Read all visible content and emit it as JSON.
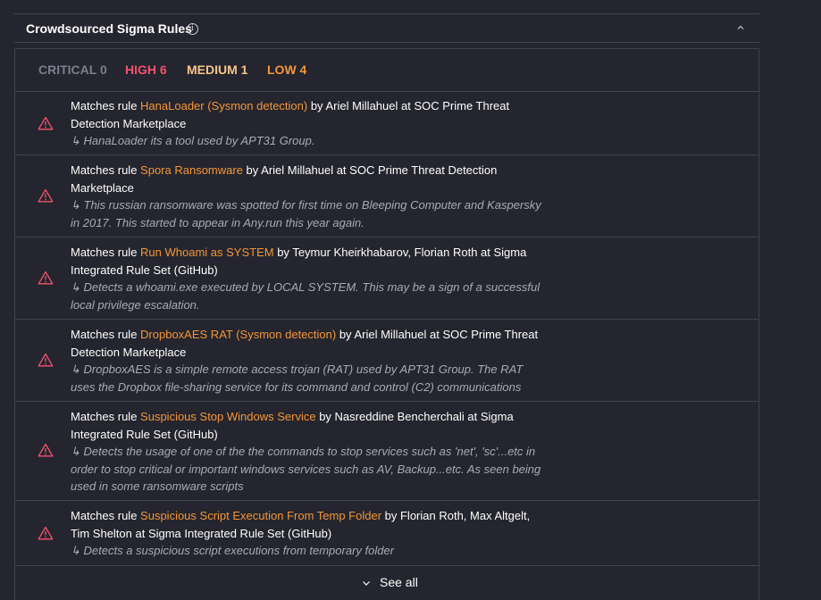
{
  "section": {
    "title": "Crowdsourced Sigma Rules",
    "info_icon": "info-icon",
    "collapse_icon": "chevron-up-icon"
  },
  "counts": [
    {
      "label": "CRITICAL 0",
      "color": "#7b7f8c"
    },
    {
      "label": "HIGH 6",
      "color": "#f5516e"
    },
    {
      "label": "MEDIUM 1",
      "color": "#f7c58a"
    },
    {
      "label": "LOW 4",
      "color": "#f59638"
    }
  ],
  "rules": [
    {
      "prefix": "Matches rule ",
      "name": "HanaLoader (Sysmon detection)",
      "suffix": " by Ariel Millahuel at SOC Prime Threat Detection Marketplace",
      "description": "↳ HanaLoader its a tool used by APT31 Group."
    },
    {
      "prefix": "Matches rule ",
      "name": "Spora Ransomware",
      "suffix": " by Ariel Millahuel at SOC Prime Threat Detection Marketplace",
      "description": "↳ This russian ransomware was spotted for first time on Bleeping Computer and Kaspersky in 2017. This started to appear in Any.run this year again."
    },
    {
      "prefix": "Matches rule ",
      "name": "Run Whoami as SYSTEM",
      "suffix": " by Teymur Kheirkhabarov, Florian Roth at Sigma Integrated Rule Set (GitHub)",
      "description": "↳ Detects a whoami.exe executed by LOCAL SYSTEM. This may be a sign of a successful local privilege escalation."
    },
    {
      "prefix": "Matches rule ",
      "name": "DropboxAES RAT (Sysmon detection)",
      "suffix": " by Ariel Millahuel at SOC Prime Threat Detection Marketplace",
      "description": "↳ DropboxAES is a simple remote access trojan (RAT) used by APT31 Group. The RAT uses the Dropbox file-sharing service for its command and control (C2) communications"
    },
    {
      "prefix": "Matches rule ",
      "name": "Suspicious Stop Windows Service",
      "suffix": " by Nasreddine Bencherchali at Sigma Integrated Rule Set (GitHub)",
      "description": "↳ Detects the usage of one of the the commands to stop services such as 'net', 'sc'...etc in order to stop critical or important windows services such as AV, Backup...etc. As seen being used in some ransomware scripts"
    },
    {
      "prefix": "Matches rule ",
      "name": "Suspicious Script Execution From Temp Folder",
      "suffix": " by Florian Roth, Max Altgelt, Tim Shelton at Sigma Integrated Rule Set (GitHub)",
      "description": "↳ Detects a suspicious script executions from temporary folder"
    }
  ],
  "see_all": {
    "label": "See all",
    "icon": "chevron-down-icon"
  },
  "colors": {
    "background": "#24252e",
    "border": "#3f4350",
    "rule_name": "#f59638",
    "warning_icon": "#f5516e",
    "description": "#a7abb7"
  }
}
